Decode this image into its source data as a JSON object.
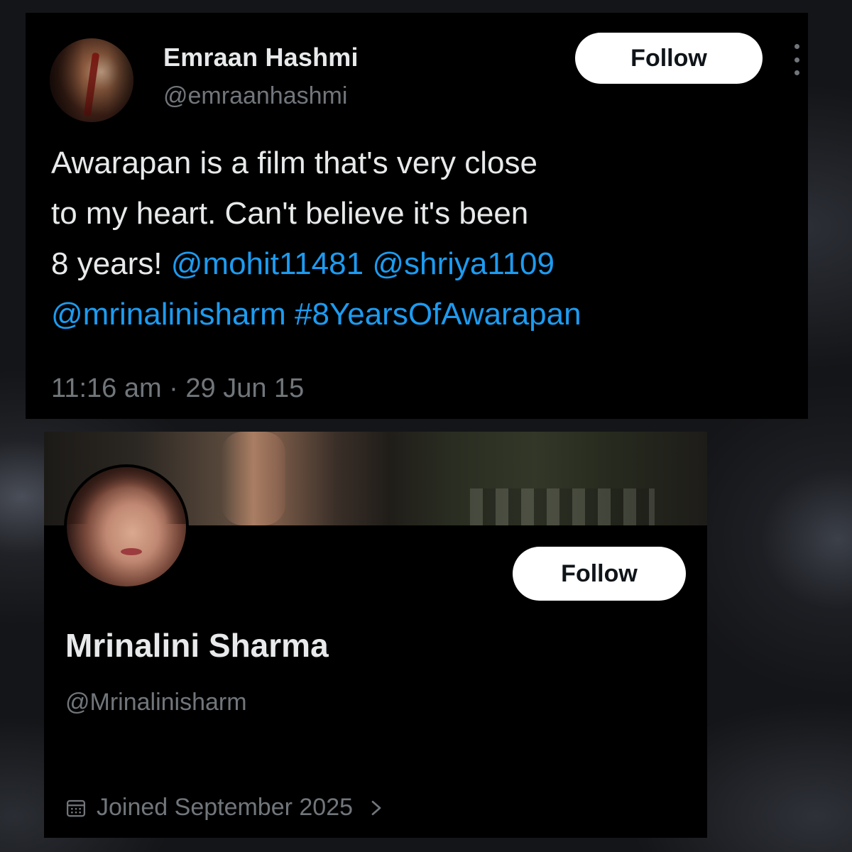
{
  "tweet": {
    "author_name": "Emraan Hashmi",
    "author_handle": "@emraanhashmi",
    "follow_label": "Follow",
    "text_line_1": "Awarapan is a film that's very close",
    "text_line_2": "to my heart. Can't believe it's been",
    "text_line_3_plain": "8 years!",
    "mention_1": "@mohit11481",
    "mention_2": "@shriya1109",
    "mention_3": "@mrinalinisharm",
    "hashtag": "#8YearsOfAwarapan",
    "timestamp": "11:16 am · 29 Jun 15",
    "link_color": "#1d9bf0",
    "more_icon": "more-vertical-icon"
  },
  "profile": {
    "name": "Mrinalini Sharma",
    "handle": "@Mrinalinisharm",
    "follow_label": "Follow",
    "joined": "Joined September 2025",
    "joined_icon": "calendar-icon",
    "chevron_icon": "chevron-right-icon"
  }
}
